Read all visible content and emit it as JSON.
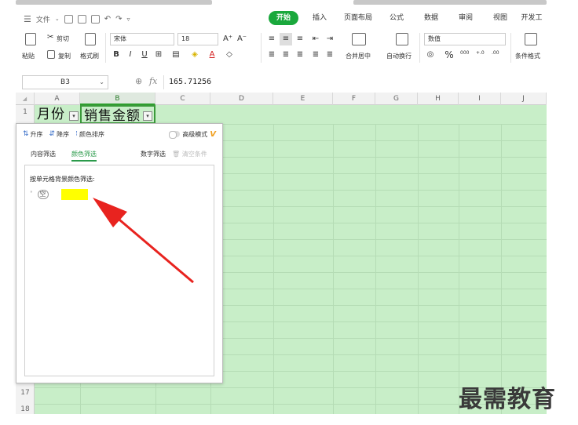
{
  "menu": {
    "file_label": "文件",
    "tabs": [
      {
        "label": "开始",
        "active": true
      },
      {
        "label": "插入",
        "active": false
      },
      {
        "label": "页面布局",
        "active": false
      },
      {
        "label": "公式",
        "active": false
      },
      {
        "label": "数据",
        "active": false
      },
      {
        "label": "审阅",
        "active": false
      },
      {
        "label": "视图",
        "active": false
      },
      {
        "label": "开发工",
        "active": false
      }
    ]
  },
  "ribbon": {
    "paste_label": "粘贴",
    "cut_label": "剪切",
    "copy_label": "复制",
    "format_painter_label": "格式刷",
    "font_name": "宋体",
    "font_size": "18",
    "merge_center_label": "合并居中",
    "wrap_text_label": "自动换行",
    "number_format": "数值",
    "conditional_format_label": "条件格式",
    "bold": "B",
    "italic": "I",
    "underline": "U",
    "percent": "%",
    "thousands": "000",
    "inc_decimal": "+.0",
    "dec_decimal": ".00",
    "font_grow": "A⁺",
    "font_shrink": "A⁻"
  },
  "formula_bar": {
    "cell_ref": "B3",
    "fx": "fx",
    "value": "165.71256"
  },
  "grid": {
    "columns": [
      "A",
      "B",
      "C",
      "D",
      "E",
      "F",
      "G",
      "H",
      "I",
      "J"
    ],
    "row1": {
      "A": "月份",
      "B": "销售金额"
    },
    "row_numbers": [
      "1",
      "17",
      "18"
    ],
    "cell_bg": "#c8eec8"
  },
  "filter_panel": {
    "asc_label": "升序",
    "desc_label": "降序",
    "color_sort_label": "颜色排序",
    "advanced_label": "高级模式",
    "advanced_badge": "V",
    "tabs": [
      {
        "label": "内容筛选",
        "active": false
      },
      {
        "label": "颜色筛选",
        "active": true
      }
    ],
    "number_filter_label": "数字筛选",
    "clear_label": "清空条件",
    "by_bg_label": "按单元格背景颜色筛选:",
    "empty_option": "空",
    "swatch_color": "#ffff00"
  },
  "watermark": "最需教育",
  "colors": {
    "accent": "#1aa83c",
    "grid_bg": "#c8eec8",
    "arrow": "#e8231f"
  }
}
